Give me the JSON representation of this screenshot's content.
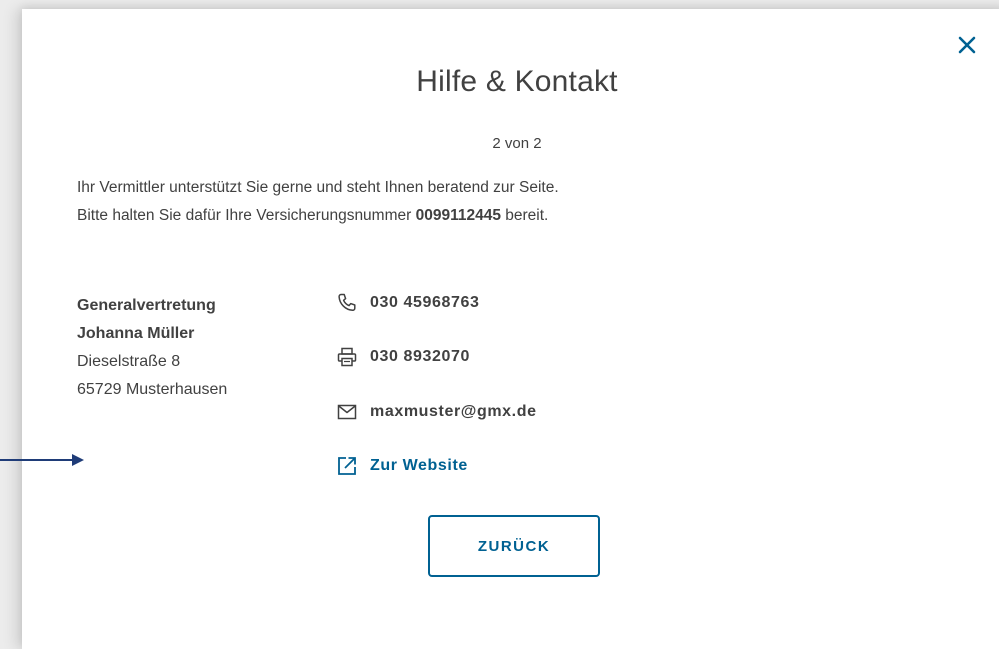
{
  "dialog": {
    "title": "Hilfe & Kontakt",
    "step": "2 von 2",
    "intro_line1": "Ihr Vermittler unterstützt Sie gerne und steht Ihnen beratend zur Seite.",
    "intro_line2_prefix": "Bitte halten Sie dafür Ihre Versicherungsnummer ",
    "policy_number": "0099112445",
    "intro_line2_suffix": " bereit."
  },
  "agent": {
    "title": "Generalvertretung",
    "name": "Johanna Müller",
    "street": "Dieselstraße 8",
    "city": "65729 Musterhausen"
  },
  "contact": {
    "phone": "030 45968763",
    "fax": "030 8932070",
    "email": "maxmuster@gmx.de",
    "website_label": "Zur Website"
  },
  "buttons": {
    "back_label": "ZURÜCK"
  },
  "colors": {
    "accent": "#006192",
    "text": "#414141",
    "background": "#ffffff",
    "arrow": "#1f3c78"
  },
  "icons": {
    "close": "close-icon",
    "phone": "phone-icon",
    "fax": "fax-icon",
    "email": "mail-icon",
    "website": "external-link-icon",
    "arrow": "arrow-right-icon"
  }
}
